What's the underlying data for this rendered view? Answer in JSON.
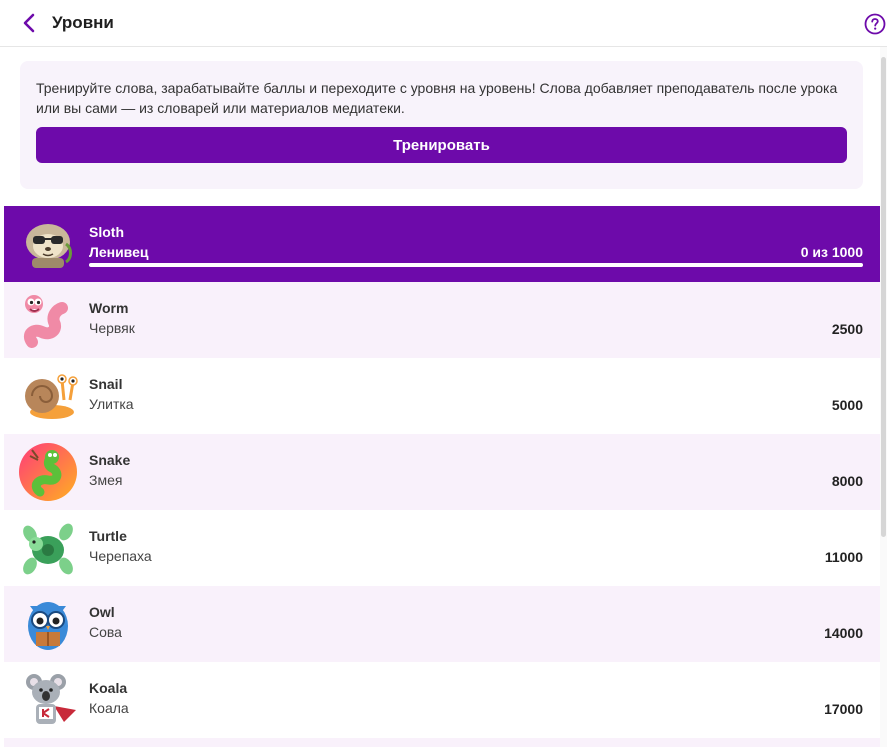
{
  "header": {
    "title": "Уровни",
    "back_icon": "chevron-left-icon",
    "help_icon": "question-circle-icon"
  },
  "info": {
    "text": "Тренируйте слова, зарабатывайте баллы и переходите с уровня на уровень! Слова добавляет преподаватель после урока или вы сами — из словарей или материалов медиатеки.",
    "button_label": "Тренировать"
  },
  "current": {
    "name": "Sloth",
    "sub": "Ленивец",
    "points": "0 из 1000",
    "progress": 0
  },
  "levels": [
    {
      "name": "Worm",
      "sub": "Червяк",
      "points": "2500"
    },
    {
      "name": "Snail",
      "sub": "Улитка",
      "points": "5000"
    },
    {
      "name": "Snake",
      "sub": "Змея",
      "points": "8000"
    },
    {
      "name": "Turtle",
      "sub": "Черепаха",
      "points": "11000"
    },
    {
      "name": "Owl",
      "sub": "Сова",
      "points": "14000"
    },
    {
      "name": "Koala",
      "sub": "Коала",
      "points": "17000"
    }
  ],
  "colors": {
    "accent": "#6d0aaa",
    "row_alt": "#f9f1fb",
    "info_bg": "#f8f3fb"
  }
}
